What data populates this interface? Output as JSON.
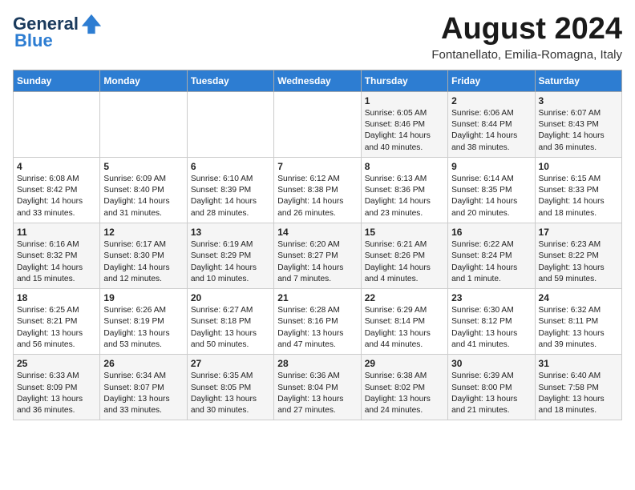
{
  "header": {
    "logo_general": "General",
    "logo_blue": "Blue",
    "month_title": "August 2024",
    "location": "Fontanellato, Emilia-Romagna, Italy"
  },
  "days_of_week": [
    "Sunday",
    "Monday",
    "Tuesday",
    "Wednesday",
    "Thursday",
    "Friday",
    "Saturday"
  ],
  "weeks": [
    [
      {
        "num": "",
        "info": ""
      },
      {
        "num": "",
        "info": ""
      },
      {
        "num": "",
        "info": ""
      },
      {
        "num": "",
        "info": ""
      },
      {
        "num": "1",
        "info": "Sunrise: 6:05 AM\nSunset: 8:46 PM\nDaylight: 14 hours and 40 minutes."
      },
      {
        "num": "2",
        "info": "Sunrise: 6:06 AM\nSunset: 8:44 PM\nDaylight: 14 hours and 38 minutes."
      },
      {
        "num": "3",
        "info": "Sunrise: 6:07 AM\nSunset: 8:43 PM\nDaylight: 14 hours and 36 minutes."
      }
    ],
    [
      {
        "num": "4",
        "info": "Sunrise: 6:08 AM\nSunset: 8:42 PM\nDaylight: 14 hours and 33 minutes."
      },
      {
        "num": "5",
        "info": "Sunrise: 6:09 AM\nSunset: 8:40 PM\nDaylight: 14 hours and 31 minutes."
      },
      {
        "num": "6",
        "info": "Sunrise: 6:10 AM\nSunset: 8:39 PM\nDaylight: 14 hours and 28 minutes."
      },
      {
        "num": "7",
        "info": "Sunrise: 6:12 AM\nSunset: 8:38 PM\nDaylight: 14 hours and 26 minutes."
      },
      {
        "num": "8",
        "info": "Sunrise: 6:13 AM\nSunset: 8:36 PM\nDaylight: 14 hours and 23 minutes."
      },
      {
        "num": "9",
        "info": "Sunrise: 6:14 AM\nSunset: 8:35 PM\nDaylight: 14 hours and 20 minutes."
      },
      {
        "num": "10",
        "info": "Sunrise: 6:15 AM\nSunset: 8:33 PM\nDaylight: 14 hours and 18 minutes."
      }
    ],
    [
      {
        "num": "11",
        "info": "Sunrise: 6:16 AM\nSunset: 8:32 PM\nDaylight: 14 hours and 15 minutes."
      },
      {
        "num": "12",
        "info": "Sunrise: 6:17 AM\nSunset: 8:30 PM\nDaylight: 14 hours and 12 minutes."
      },
      {
        "num": "13",
        "info": "Sunrise: 6:19 AM\nSunset: 8:29 PM\nDaylight: 14 hours and 10 minutes."
      },
      {
        "num": "14",
        "info": "Sunrise: 6:20 AM\nSunset: 8:27 PM\nDaylight: 14 hours and 7 minutes."
      },
      {
        "num": "15",
        "info": "Sunrise: 6:21 AM\nSunset: 8:26 PM\nDaylight: 14 hours and 4 minutes."
      },
      {
        "num": "16",
        "info": "Sunrise: 6:22 AM\nSunset: 8:24 PM\nDaylight: 14 hours and 1 minute."
      },
      {
        "num": "17",
        "info": "Sunrise: 6:23 AM\nSunset: 8:22 PM\nDaylight: 13 hours and 59 minutes."
      }
    ],
    [
      {
        "num": "18",
        "info": "Sunrise: 6:25 AM\nSunset: 8:21 PM\nDaylight: 13 hours and 56 minutes."
      },
      {
        "num": "19",
        "info": "Sunrise: 6:26 AM\nSunset: 8:19 PM\nDaylight: 13 hours and 53 minutes."
      },
      {
        "num": "20",
        "info": "Sunrise: 6:27 AM\nSunset: 8:18 PM\nDaylight: 13 hours and 50 minutes."
      },
      {
        "num": "21",
        "info": "Sunrise: 6:28 AM\nSunset: 8:16 PM\nDaylight: 13 hours and 47 minutes."
      },
      {
        "num": "22",
        "info": "Sunrise: 6:29 AM\nSunset: 8:14 PM\nDaylight: 13 hours and 44 minutes."
      },
      {
        "num": "23",
        "info": "Sunrise: 6:30 AM\nSunset: 8:12 PM\nDaylight: 13 hours and 41 minutes."
      },
      {
        "num": "24",
        "info": "Sunrise: 6:32 AM\nSunset: 8:11 PM\nDaylight: 13 hours and 39 minutes."
      }
    ],
    [
      {
        "num": "25",
        "info": "Sunrise: 6:33 AM\nSunset: 8:09 PM\nDaylight: 13 hours and 36 minutes."
      },
      {
        "num": "26",
        "info": "Sunrise: 6:34 AM\nSunset: 8:07 PM\nDaylight: 13 hours and 33 minutes."
      },
      {
        "num": "27",
        "info": "Sunrise: 6:35 AM\nSunset: 8:05 PM\nDaylight: 13 hours and 30 minutes."
      },
      {
        "num": "28",
        "info": "Sunrise: 6:36 AM\nSunset: 8:04 PM\nDaylight: 13 hours and 27 minutes."
      },
      {
        "num": "29",
        "info": "Sunrise: 6:38 AM\nSunset: 8:02 PM\nDaylight: 13 hours and 24 minutes."
      },
      {
        "num": "30",
        "info": "Sunrise: 6:39 AM\nSunset: 8:00 PM\nDaylight: 13 hours and 21 minutes."
      },
      {
        "num": "31",
        "info": "Sunrise: 6:40 AM\nSunset: 7:58 PM\nDaylight: 13 hours and 18 minutes."
      }
    ]
  ]
}
